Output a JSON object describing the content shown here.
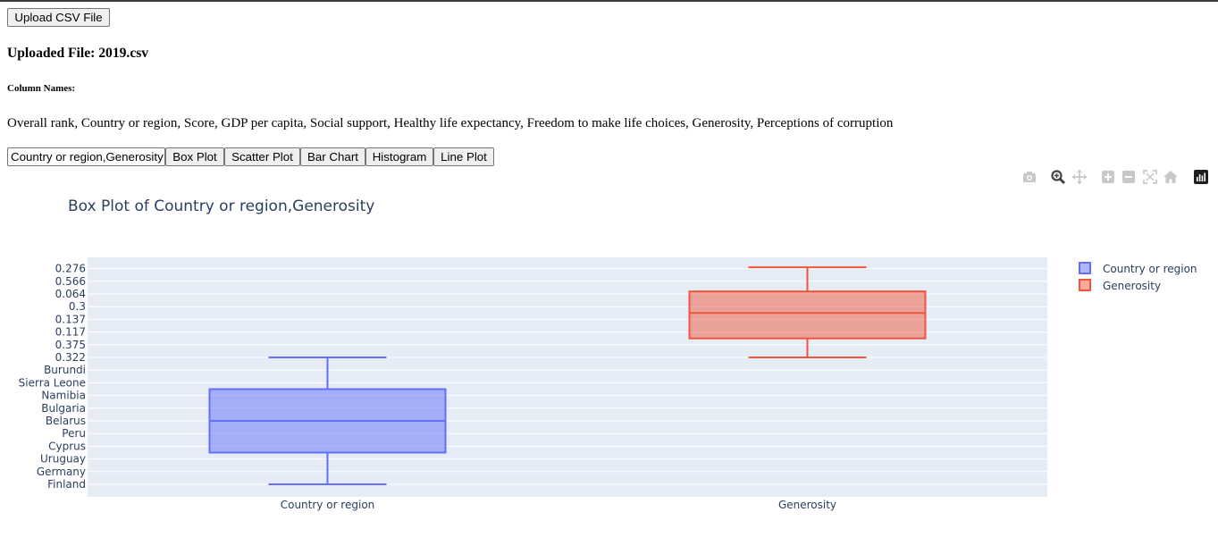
{
  "upload_button": "Upload CSV File",
  "uploaded_file": "Uploaded File: 2019.csv",
  "column_names_heading": "Column Names:",
  "column_names": "Overall rank, Country or region, Score, GDP per capita, Social support, Healthy life expectancy, Freedom to make life choices, Generosity, Perceptions of corruption",
  "selected_columns": "Country or region,Generosity",
  "plot_buttons": {
    "box": "Box Plot",
    "scatter": "Scatter Plot",
    "bar": "Bar Chart",
    "histogram": "Histogram",
    "line": "Line Plot"
  },
  "modebar_icons": [
    "camera-icon",
    "zoom-icon",
    "pan-icon",
    "zoom-in-icon",
    "zoom-out-icon",
    "autoscale-icon",
    "reset-axes-icon",
    "plotly-logo-icon"
  ],
  "colors": {
    "series1": "#636efa",
    "series2": "#ef553b",
    "plot_bg": "#e5ecf6",
    "title": "#2a3f5f"
  },
  "chart_data": {
    "type": "box",
    "title": "Box Plot of Country or region,Generosity",
    "categories": [
      "Country or region",
      "Generosity"
    ],
    "yaxis_type": "category",
    "y_tick_labels": [
      "Finland",
      "Germany",
      "Uruguay",
      "Cyprus",
      "Peru",
      "Belarus",
      "Bulgaria",
      "Namibia",
      "Sierra Leone",
      "Burundi",
      "0.322",
      "0.375",
      "0.117",
      "0.137",
      "0.3",
      "0.064",
      "0.566",
      "0.276"
    ],
    "series": [
      {
        "name": "Country or region",
        "color": "#636efa",
        "lower_fence": 0,
        "q1": 2.5,
        "median": 5,
        "q3": 7.5,
        "upper_fence": 10
      },
      {
        "name": "Generosity",
        "color": "#ef553b",
        "lower_fence": 10,
        "q1": 11.5,
        "median": 13.5,
        "q3": 15.2,
        "upper_fence": 17.1
      }
    ],
    "legend": "right",
    "grid": true
  }
}
